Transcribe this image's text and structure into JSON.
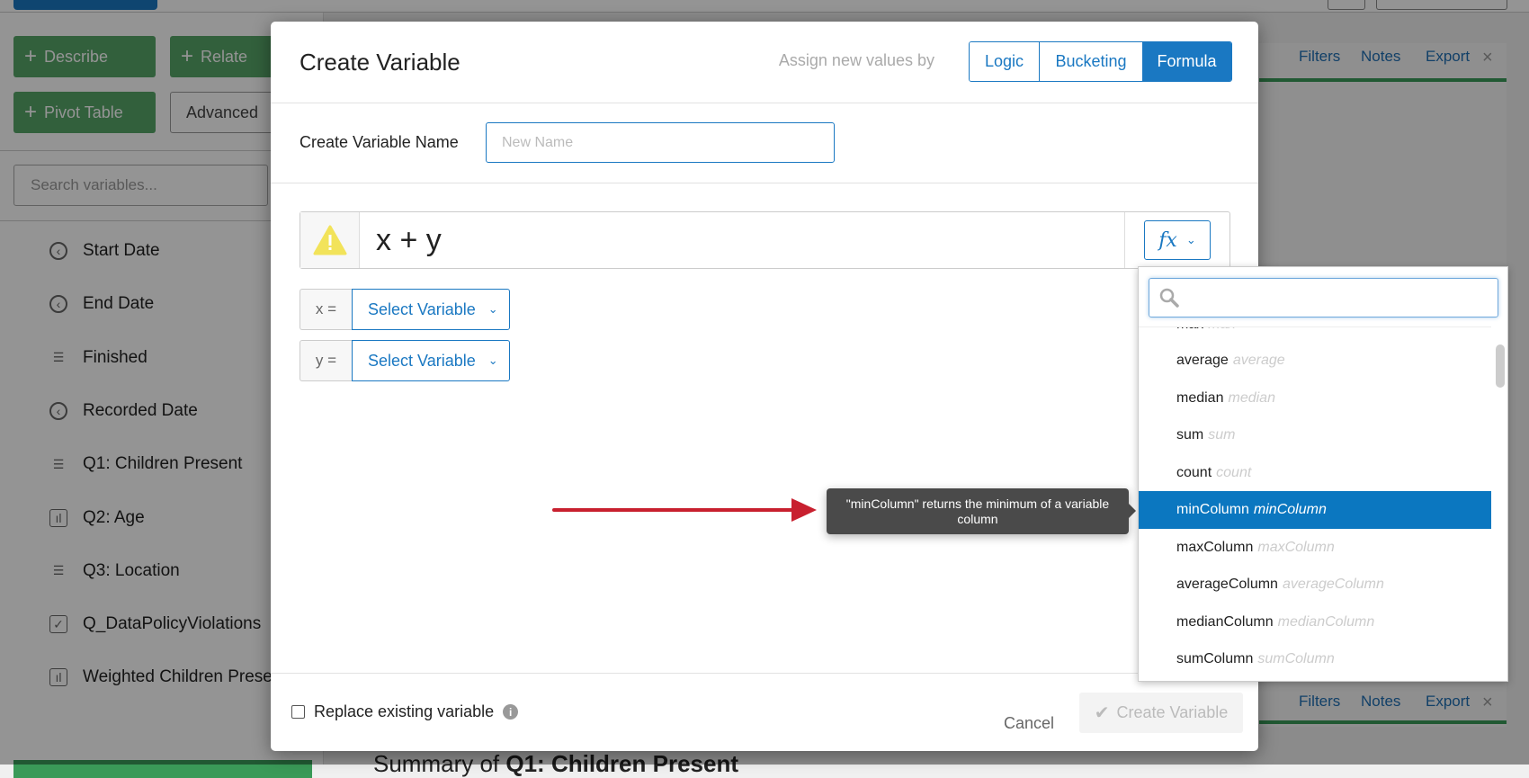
{
  "background": {
    "toolbar": {
      "describe": "Describe",
      "relate": "Relate",
      "pivot_table": "Pivot Table",
      "advanced": "Advanced"
    },
    "search_placeholder": "Search variables...",
    "variables": [
      {
        "icon": "clock-icon",
        "label": "Start Date"
      },
      {
        "icon": "clock-icon",
        "label": "End Date"
      },
      {
        "icon": "list-icon",
        "label": "Finished"
      },
      {
        "icon": "clock-icon",
        "label": "Recorded Date"
      },
      {
        "icon": "list-icon",
        "label": "Q1: Children Present"
      },
      {
        "icon": "bar-chart-icon",
        "label": "Q2: Age"
      },
      {
        "icon": "list-icon",
        "label": "Q3: Location"
      },
      {
        "icon": "checkbox-icon",
        "label": "Q_DataPolicyViolations"
      },
      {
        "icon": "bar-chart-icon",
        "label": "Weighted Children Prese"
      }
    ],
    "panel_links": {
      "filters": "Filters",
      "notes": "Notes",
      "export": "Export",
      "close": "×"
    },
    "summary_title": "Summary of ",
    "summary_bold": "Q1: Children Present"
  },
  "modal": {
    "title": "Create Variable",
    "assign_label": "Assign new values by",
    "modes": [
      {
        "label": "Logic",
        "active": false
      },
      {
        "label": "Bucketing",
        "active": false
      },
      {
        "label": "Formula",
        "active": true
      }
    ],
    "name_label": "Create Variable Name",
    "name_placeholder": "New Name",
    "formula": "x + y",
    "fx_label": "fx",
    "vars": [
      {
        "label": "x =",
        "select": "Select Variable"
      },
      {
        "label": "y =",
        "select": "Select Variable"
      }
    ],
    "replace_label": "Replace existing variable",
    "info": "i",
    "cancel": "Cancel",
    "create": "Create Variable"
  },
  "dropdown": {
    "partial_item": {
      "name": "max",
      "hint": "max"
    },
    "items": [
      {
        "name": "average",
        "hint": "average"
      },
      {
        "name": "median",
        "hint": "median"
      },
      {
        "name": "sum",
        "hint": "sum"
      },
      {
        "name": "count",
        "hint": "count"
      },
      {
        "name": "minColumn",
        "hint": "minColumn",
        "selected": true
      },
      {
        "name": "maxColumn",
        "hint": "maxColumn"
      },
      {
        "name": "averageColumn",
        "hint": "averageColumn"
      },
      {
        "name": "medianColumn",
        "hint": "medianColumn"
      },
      {
        "name": "sumColumn",
        "hint": "sumColumn"
      }
    ]
  },
  "tooltip": "\"minColumn\" returns the minimum of a variable column",
  "colors": {
    "accent": "#1a78c2",
    "green": "#56a568",
    "arrow": "#c8202f",
    "warning": "#f2e35a"
  }
}
